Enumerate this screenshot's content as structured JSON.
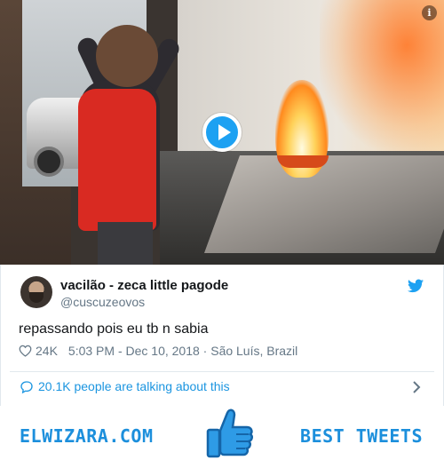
{
  "video": {
    "info_label": "i"
  },
  "tweet": {
    "display_name": "vacilão - zeca little pagode",
    "username": "@cuscuzeovos",
    "text": "repassando pois eu tb n sabia",
    "likes": "24K",
    "timestamp": "5:03 PM - Dec 10, 2018 · São Luís, Brazil",
    "conversation": "20.1K people are talking about this"
  },
  "banner": {
    "left_text": "ELWIZARA.COM",
    "right_text": "BEST TWEETS"
  },
  "colors": {
    "twitter_blue": "#1da1f2",
    "link_blue": "#1b95e0",
    "banner_blue": "#1c8fdc",
    "secondary_text": "#657786"
  },
  "icons": [
    "info-icon",
    "play-icon",
    "twitter-bird-icon",
    "heart-icon",
    "speech-bubble-icon",
    "chevron-right-icon",
    "thumbs-up-icon"
  ]
}
